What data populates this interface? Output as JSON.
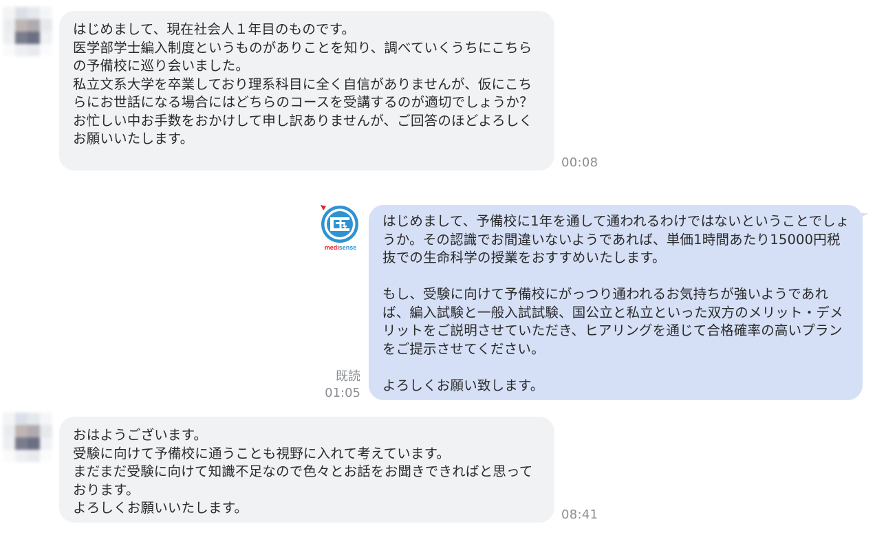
{
  "colors": {
    "incoming_bubble": "#f1f2f4",
    "outgoing_bubble": "#d5dff5",
    "timestamp": "#8a8d94",
    "logo_blue": "#2f93d2",
    "logo_red": "#d9252b"
  },
  "messages": [
    {
      "direction": "incoming",
      "avatar": "pixelated-user-avatar",
      "text": "はじめまして、現在社会人１年目のものです。\n医学部学士編入制度というものがありことを知り、調べていくうちにこちらの予備校に巡り会いました。\n私立文系大学を卒業しており理系科目に全く自信がありませんが、仮にこちらにお世話になる場合にはどちらのコースを受講するのが適切でしょうか？\nお忙しい中お手数をおかけして申し訳ありませんが、ご回答のほどよろしくお願いいたします。",
      "time": "00:08"
    },
    {
      "direction": "outgoing",
      "avatar": "medisense-logo",
      "logo_text_medi": "medi",
      "logo_text_sense": "sense",
      "text": "はじめまして、予備校に1年を通して通われるわけではないということでしょうか。その認識でお間違いないようであれば、単価1時間あたり15000円税抜での生命科学の授業をおすすめいたします。\n\nもし、受験に向けて予備校にがっつり通われるお気持ちが強いようであれば、編入試験と一般入試試験、国公立と私立といった双方のメリット・デメリットをご説明させていただき、ヒアリングを通じて合格確率の高いプランをご提示させてください。\n\nよろしくお願い致します。",
      "read_label": "既読",
      "time": "01:05"
    },
    {
      "direction": "incoming",
      "avatar": "pixelated-user-avatar",
      "text": "おはようございます。\n受験に向けて予備校に通うことも視野に入れて考えています。\nまだまだ受験に向けて知識不足なので色々とお話をお聞きできればと思っております。\nよろしくお願いいたします。",
      "time": "08:41"
    }
  ]
}
